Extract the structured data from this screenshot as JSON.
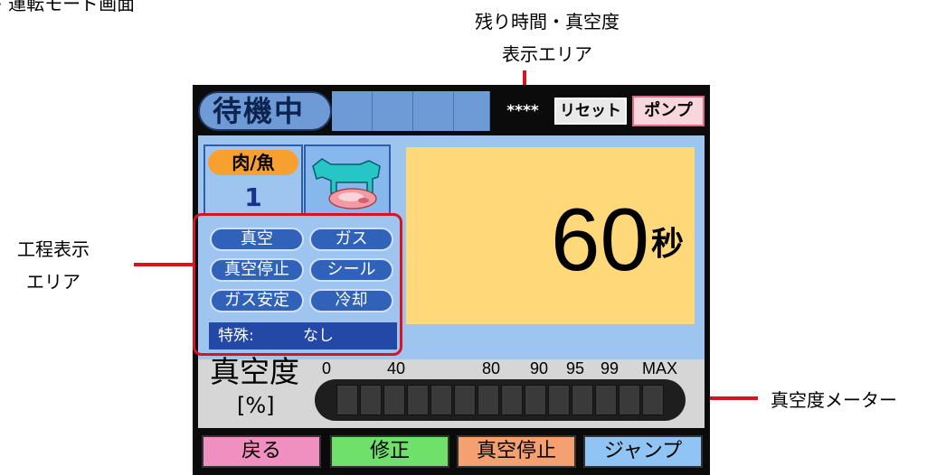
{
  "annotations": {
    "top_left_label": "> 運転モード画面",
    "remaining_time_label_line1": "残り時間・真空度",
    "remaining_time_label_line2": "表示エリア",
    "process_label_line1": "工程表示",
    "process_label_line2": "エリア",
    "meter_label": "真空度メーター"
  },
  "header": {
    "status": "待機中",
    "stars": "****",
    "reset_label": "リセット",
    "pump_label": "ポンプ"
  },
  "mode": {
    "category": "肉/魚",
    "number": "1",
    "icon": "cow-meat-icon"
  },
  "process_steps": [
    "真空",
    "ガス",
    "真空停止",
    "シール",
    "ガス安定",
    "冷却"
  ],
  "special": {
    "label": "特殊:",
    "value": "なし"
  },
  "timer": {
    "value": "60",
    "unit": "秒"
  },
  "vacuum_meter": {
    "title": "真空度",
    "unit": "[%]",
    "ticks": [
      "0",
      "40",
      "80",
      "90",
      "95",
      "99",
      "MAX"
    ],
    "level_fraction": 0
  },
  "footer": {
    "back": "戻る",
    "edit": "修正",
    "vacuum_stop": "真空停止",
    "jump": "ジャンプ"
  },
  "colors": {
    "annotation_red": "#d8141e",
    "header_blue": "#6e9bd6",
    "timer_bg": "#ffd87a",
    "back_btn": "#f090c0",
    "edit_btn": "#6fe06a",
    "stop_btn": "#f4a070",
    "jump_btn": "#90c4f4"
  }
}
